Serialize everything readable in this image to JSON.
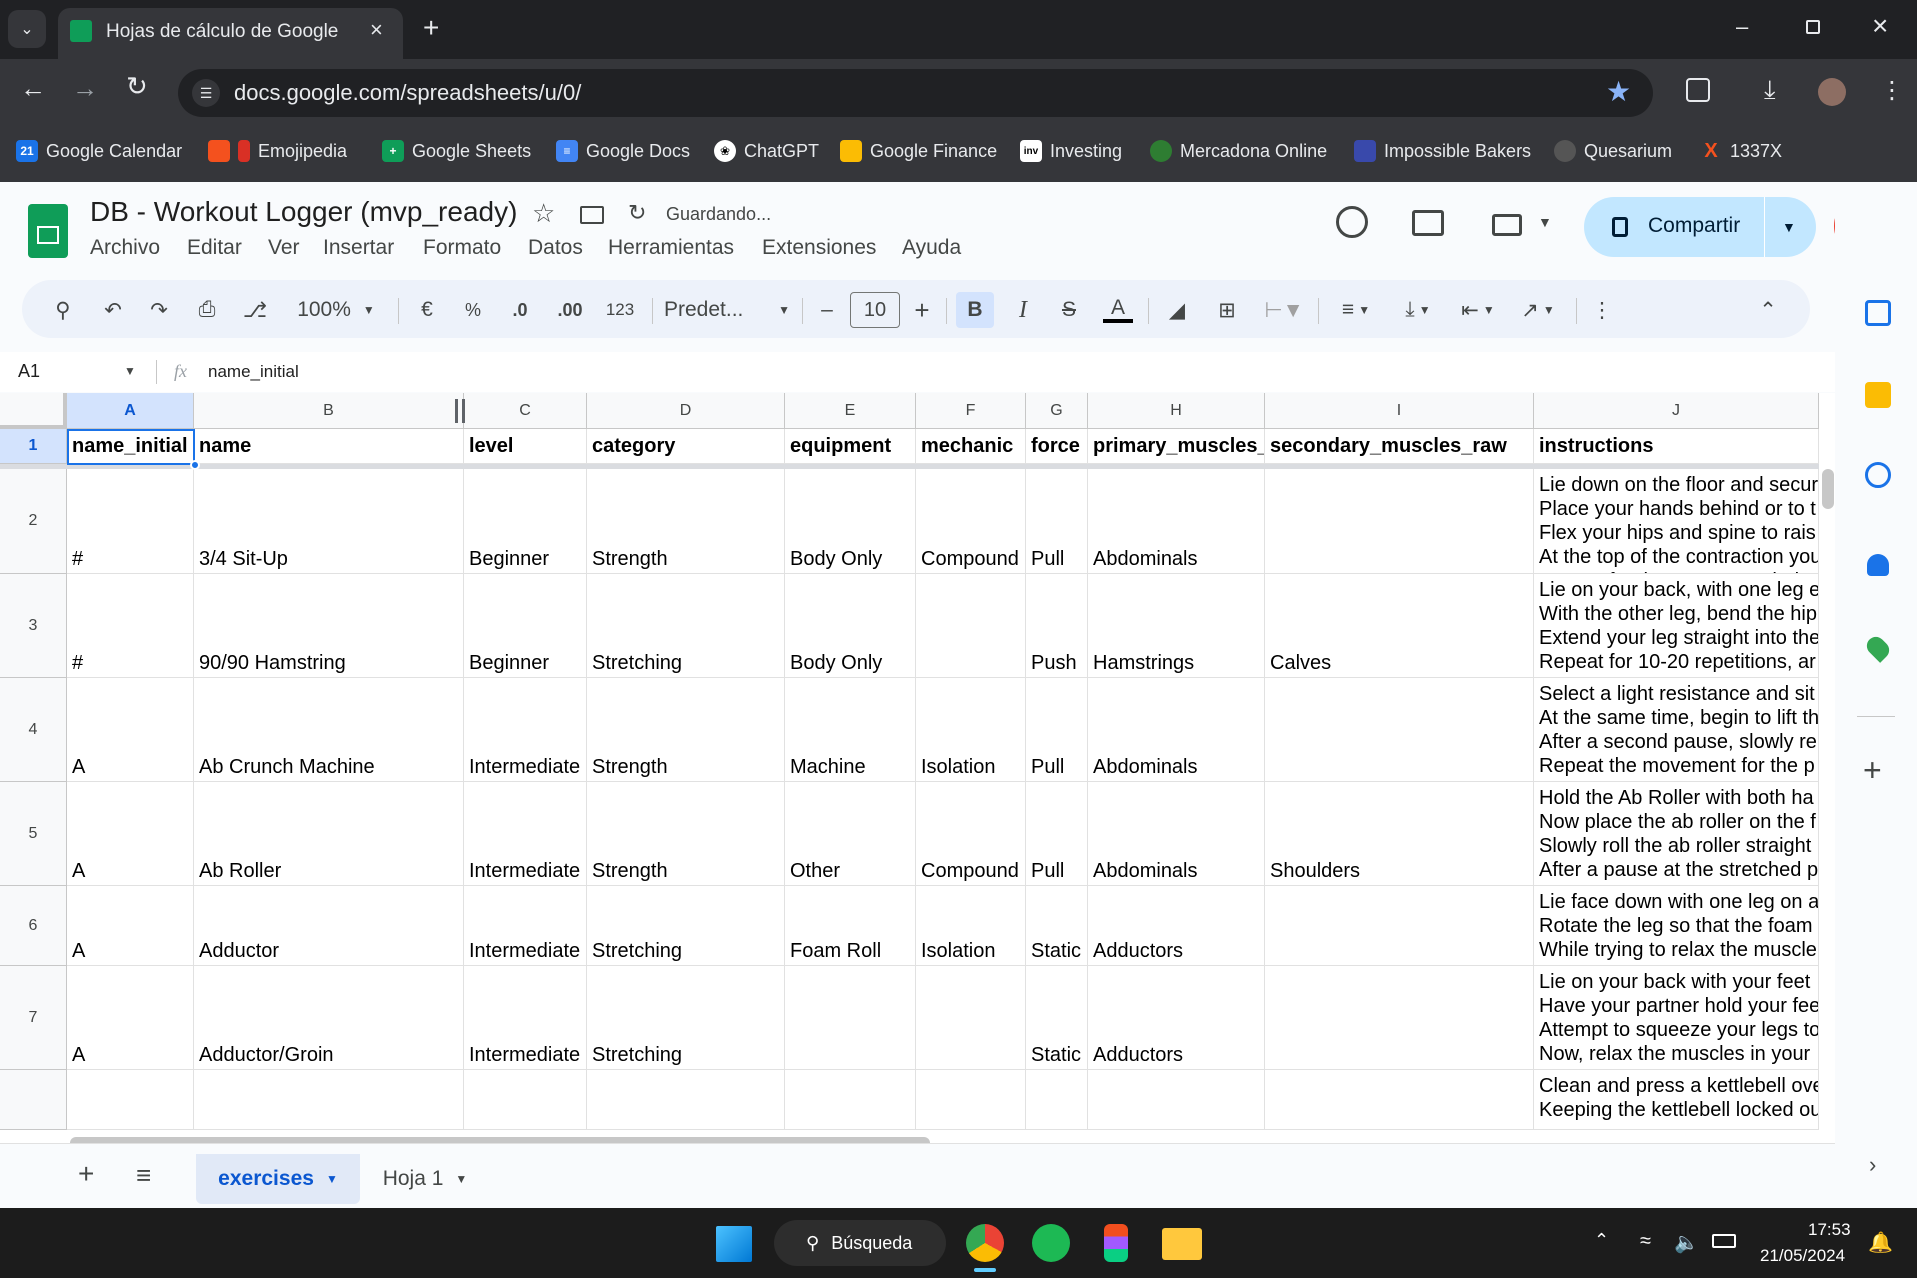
{
  "browser": {
    "tab_title": "Hojas de cálculo de Google",
    "url": "docs.google.com/spreadsheets/u/0/",
    "bookmarks": [
      {
        "label": "Google Calendar",
        "icon": "calendar-icon",
        "color": "#1a73e8"
      },
      {
        "label": "Emojipedia",
        "icon": "emojipedia-icon",
        "color": "#f4511e"
      },
      {
        "label": "Google Sheets",
        "icon": "sheets-icon",
        "color": "#0f9d58"
      },
      {
        "label": "Google Docs",
        "icon": "docs-icon",
        "color": "#4285f4"
      },
      {
        "label": "ChatGPT",
        "icon": "chatgpt-icon",
        "color": "#ffffff"
      },
      {
        "label": "Google Finance",
        "icon": "finance-icon",
        "color": "#fbbc04"
      },
      {
        "label": "Investing",
        "icon": "investing-icon",
        "color": "#ffffff"
      },
      {
        "label": "Mercadona Online",
        "icon": "mercadona-icon",
        "color": "#2e7d32"
      },
      {
        "label": "Impossible Bakers",
        "icon": "bakers-icon",
        "color": "#3949ab"
      },
      {
        "label": "Quesarium",
        "icon": "quesarium-icon",
        "color": "#9e9e9e"
      },
      {
        "label": "1337X",
        "icon": "1337x-icon",
        "color": "#f4511e"
      }
    ]
  },
  "doc": {
    "title": "DB - Workout Logger (mvp_ready)",
    "saving_status": "Guardando...",
    "menus": [
      "Archivo",
      "Editar",
      "Ver",
      "Insertar",
      "Formato",
      "Datos",
      "Herramientas",
      "Extensiones",
      "Ayuda"
    ],
    "share_label": "Compartir"
  },
  "toolbar": {
    "zoom": "100%",
    "currency": "€",
    "percent": "%",
    "decrease_decimals": ".0",
    "increase_decimals": ".00",
    "number_format": "123",
    "font": "Predet...",
    "font_size": "10",
    "bold": "B",
    "italic": "I",
    "text_color_letter": "A"
  },
  "formula_bar": {
    "cell_ref": "A1",
    "fx": "fx",
    "content": "name_initial"
  },
  "sheet": {
    "columns": [
      "A",
      "B",
      "C",
      "D",
      "E",
      "F",
      "G",
      "H",
      "I",
      "J"
    ],
    "rows": [
      {
        "num": "1",
        "cells": [
          "name_initial",
          "name",
          "level",
          "category",
          "equipment",
          "mechanic",
          "force",
          "primary_muscles_",
          "secondary_muscles_raw",
          "instructions"
        ]
      },
      {
        "num": "2",
        "cells": [
          "#",
          "3/4 Sit-Up",
          "Beginner",
          "Strength",
          "Body Only",
          "Compound",
          "Pull",
          "Abdominals",
          "",
          "Lie down on the floor and secur\nPlace your hands behind or to t\nFlex your hips and spine to rais\nAt the top of the contraction you\nRepeat for the recommended a"
        ]
      },
      {
        "num": "3",
        "cells": [
          "#",
          "90/90 Hamstring",
          "Beginner",
          "Stretching",
          "Body Only",
          "",
          "Push",
          "Hamstrings",
          "Calves",
          "Lie on your back, with one leg e\nWith the other leg, bend the hip\nExtend your leg straight into the\nRepeat for 10-20 repetitions, ar"
        ]
      },
      {
        "num": "4",
        "cells": [
          "A",
          "Ab Crunch Machine",
          "Intermediate",
          "Strength",
          "Machine",
          "Isolation",
          "Pull",
          "Abdominals",
          "",
          "Select a light resistance and sit\nAt the same time, begin to lift th\nAfter a second pause, slowly re\nRepeat the movement for the p"
        ]
      },
      {
        "num": "5",
        "cells": [
          "A",
          "Ab Roller",
          "Intermediate",
          "Strength",
          "Other",
          "Compound",
          "Pull",
          "Abdominals",
          "Shoulders",
          "Hold the Ab Roller with both ha\nNow place the ab roller on the f\nSlowly roll the ab roller straight\nAfter a pause at the stretched p"
        ]
      },
      {
        "num": "6",
        "cells": [
          "A",
          "Adductor",
          "Intermediate",
          "Stretching",
          "Foam Roll",
          "Isolation",
          "Static",
          "Adductors",
          "",
          "Lie face down with one leg on a\nRotate the leg so that the foam\nWhile trying to relax the muscle"
        ]
      },
      {
        "num": "7",
        "cells": [
          "A",
          "Adductor/Groin",
          "Intermediate",
          "Stretching",
          "",
          "",
          "Static",
          "Adductors",
          "",
          "Lie on your back with your feet\nHave your partner hold your fee\nAttempt to squeeze your legs to\nNow, relax the muscles in your"
        ]
      },
      {
        "num": "",
        "cells": [
          "",
          "",
          "",
          "",
          "",
          "",
          "",
          "",
          "",
          "Clean and press a kettlebell ove\nKeeping the kettlebell locked ou"
        ]
      }
    ]
  },
  "sheet_tabs": [
    {
      "label": "exercises",
      "active": true
    },
    {
      "label": "Hoja 1",
      "active": false
    }
  ],
  "taskbar": {
    "search_label": "Búsqueda",
    "time": "17:53",
    "date": "21/05/2024"
  },
  "colors": {
    "sheets_green": "#0f9d58",
    "share_bg": "#c2e7ff",
    "selection_blue": "#1a73e8",
    "active_tab_bg": "#e1e9f7"
  }
}
